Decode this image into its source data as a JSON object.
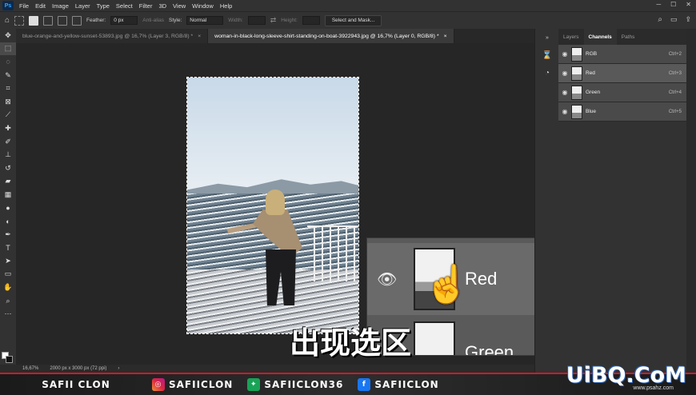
{
  "menu": {
    "logo": "Ps",
    "items": [
      "File",
      "Edit",
      "Image",
      "Layer",
      "Type",
      "Select",
      "Filter",
      "3D",
      "View",
      "Window",
      "Help"
    ]
  },
  "options": {
    "feather_label": "Feather:",
    "feather_value": "0 px",
    "antialias_label": "Anti-alias",
    "style_label": "Style:",
    "style_value": "Normal",
    "width_label": "Width:",
    "height_label": "Height:",
    "select_mask_label": "Select and Mask..."
  },
  "doc_tabs": [
    {
      "label": "blue-orange-and-yellow-sunset-53893.jpg @ 16,7% (Layer 3, RGB/8) *",
      "close": "×"
    },
    {
      "label": "woman-in-black-long-sleeve-shirt-standing-on-boat-3922943.jpg @ 16,7% (Layer 0, RGB/8) *",
      "close": "×"
    }
  ],
  "panel": {
    "tabs": [
      "Layers",
      "Channels",
      "Paths"
    ],
    "channels": [
      {
        "name": "RGB",
        "shortcut": "Ctrl+2"
      },
      {
        "name": "Red",
        "shortcut": "Ctrl+3"
      },
      {
        "name": "Green",
        "shortcut": "Ctrl+4"
      },
      {
        "name": "Blue",
        "shortcut": "Ctrl+5"
      }
    ]
  },
  "zoom": {
    "selected": "Red",
    "next": "Green"
  },
  "subtitle": "出现选区",
  "status": {
    "zoom": "16,67%",
    "doc_info": "2000 px x 3000 px (72 ppi)"
  },
  "footer": {
    "name": "SAFII CLON",
    "instagram": "SAFIICLON",
    "other": "SAFIICLON36",
    "facebook": "SAFIICLON"
  },
  "watermark": "UiBQ.CoM",
  "watermark_sub": "www.psahz.com"
}
